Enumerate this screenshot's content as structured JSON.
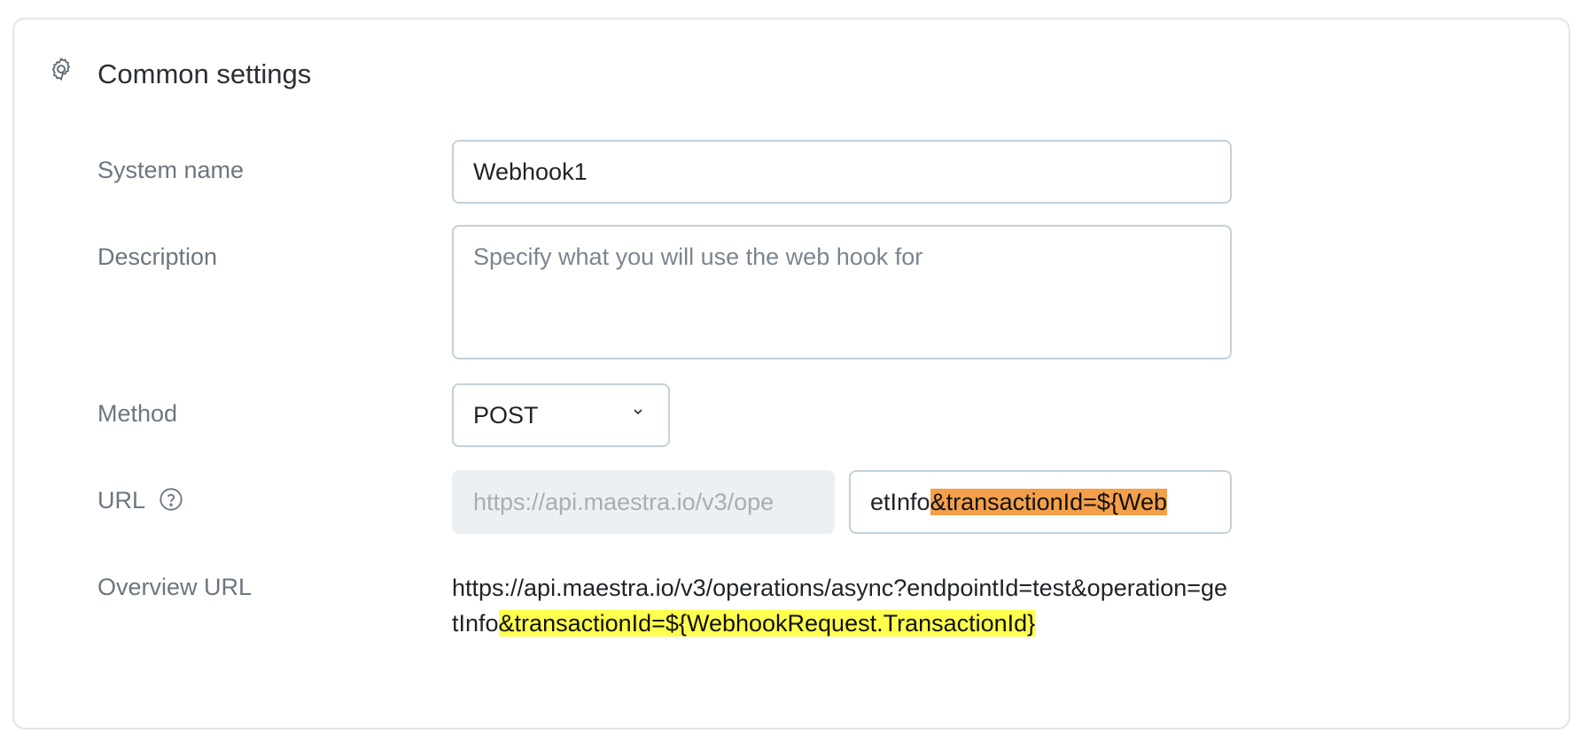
{
  "section": {
    "title": "Common settings",
    "icon": "gear-icon"
  },
  "form": {
    "system_name": {
      "label": "System name",
      "value": "Webhook1"
    },
    "description": {
      "label": "Description",
      "placeholder": "Specify what you will use the web hook for"
    },
    "method": {
      "label": "Method",
      "value": "POST",
      "icon": "chevron-down-icon"
    },
    "url": {
      "label": "URL",
      "help_icon": "question-circle-icon",
      "prefix": "https://api.maestra.io/v3/ope",
      "suffix_plain": "etInfo",
      "suffix_highlight": "&transactionId=${Web"
    },
    "overview_url": {
      "label": "Overview URL",
      "plain": "https://api.maestra.io/v3/operations/async?endpointId=test&operation=getInfo",
      "highlight": "&transactionId=${WebhookRequest.TransactionId}"
    }
  },
  "colors": {
    "highlight_orange": "#f4a04a",
    "highlight_yellow": "#ffff4d",
    "border": "#c5d0d9"
  }
}
